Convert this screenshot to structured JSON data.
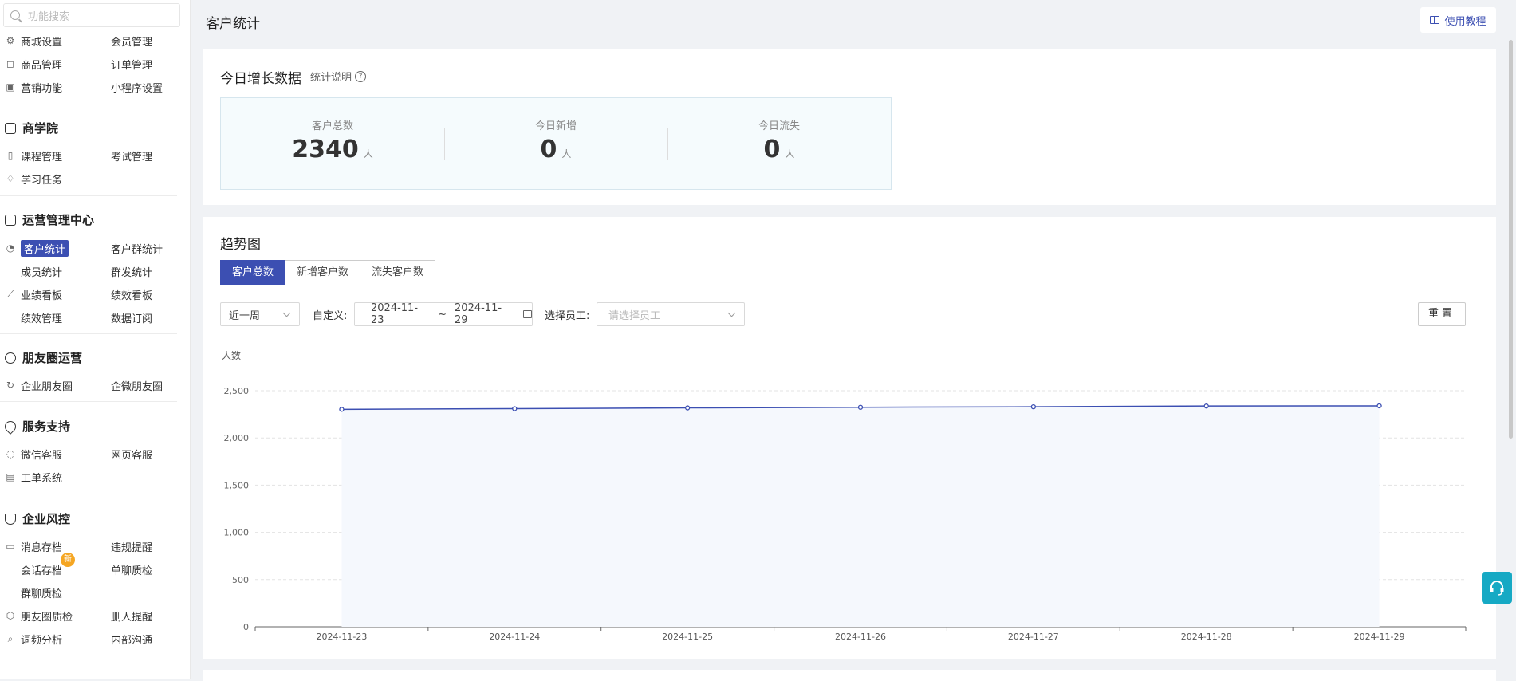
{
  "search": {
    "placeholder": "功能搜索"
  },
  "sidebar": {
    "top_items": [
      {
        "label": "商城设置",
        "icon": "gear-icon"
      },
      {
        "label": "会员管理"
      },
      {
        "label": "商品管理",
        "icon": "bag-icon"
      },
      {
        "label": "订单管理"
      },
      {
        "label": "营销功能",
        "icon": "gift-icon"
      },
      {
        "label": "小程序设置"
      }
    ],
    "groups": [
      {
        "title": "商学院",
        "items": [
          "课程管理",
          "考试管理",
          "学习任务"
        ]
      },
      {
        "title": "运营管理中心",
        "items": [
          "客户统计",
          "客户群统计",
          "成员统计",
          "群发统计",
          "业绩看板",
          "绩效看板",
          "绩效管理",
          "数据订阅"
        ]
      },
      {
        "title": "朋友圈运营",
        "items": [
          "企业朋友圈",
          "企微朋友圈"
        ]
      },
      {
        "title": "服务支持",
        "items": [
          "微信客服",
          "网页客服",
          "工单系统"
        ]
      },
      {
        "title": "企业风控",
        "items": [
          "消息存档",
          "违规提醒",
          "会话存档",
          "单聊质检",
          "群聊质检",
          "朋友圈质检",
          "删人提醒",
          "词频分析",
          "内部沟通"
        ]
      }
    ],
    "new_badge": "新",
    "active_item": "客户统计"
  },
  "header": {
    "title": "客户统计",
    "help_label": "使用教程"
  },
  "today": {
    "title": "今日增长数据",
    "explain": "统计说明",
    "stats": [
      {
        "label": "客户总数",
        "value": "2340",
        "unit": "人"
      },
      {
        "label": "今日新增",
        "value": "0",
        "unit": "人"
      },
      {
        "label": "今日流失",
        "value": "0",
        "unit": "人"
      }
    ]
  },
  "trend": {
    "title": "趋势图",
    "tabs": [
      "客户总数",
      "新增客户数",
      "流失客户数"
    ],
    "active_tab": 0,
    "period_select": "近一周",
    "custom_label": "自定义:",
    "date_start": "2024-11-23",
    "date_sep": "~",
    "date_end": "2024-11-29",
    "employee_label": "选择员工:",
    "employee_placeholder": "请选择员工",
    "reset_label": "重置"
  },
  "chart_data": {
    "type": "area",
    "ylabel": "人数",
    "x": [
      "2024-11-23",
      "2024-11-24",
      "2024-11-25",
      "2024-11-26",
      "2024-11-27",
      "2024-11-28",
      "2024-11-29"
    ],
    "series": [
      {
        "values": [
          2303,
          2310,
          2318,
          2325,
          2330,
          2338,
          2340
        ]
      }
    ],
    "ylim": [
      0,
      2500
    ],
    "yticks": [
      0,
      500,
      1000,
      1500,
      2000,
      2500
    ],
    "ytick_labels": [
      "0",
      "500",
      "1,000",
      "1,500",
      "2,000",
      "2,500"
    ],
    "grid": true,
    "color": "#3c4fb2",
    "area_color": "#f5f8fd"
  },
  "colors": {
    "primary": "#3c4fb2",
    "support": "#16a9c4",
    "badge": "#f5a623"
  }
}
